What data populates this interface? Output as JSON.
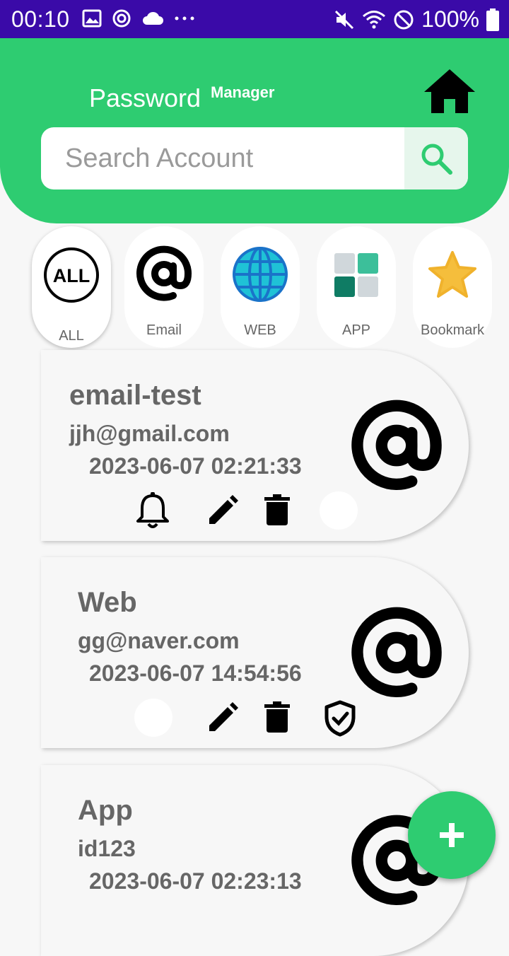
{
  "status_bar": {
    "time": "00:10",
    "battery": "100%"
  },
  "header": {
    "title": "Password",
    "title_sup": "Manager"
  },
  "search": {
    "placeholder": "Search Account"
  },
  "categories": [
    {
      "label": "ALL",
      "icon": "all-icon",
      "icon_text": "ALL",
      "active": true
    },
    {
      "label": "Email",
      "icon": "at-icon",
      "active": false
    },
    {
      "label": "WEB",
      "icon": "globe-icon",
      "active": false
    },
    {
      "label": "APP",
      "icon": "app-icon",
      "active": false
    },
    {
      "label": "Bookmark",
      "icon": "star-icon",
      "active": false
    }
  ],
  "accounts": [
    {
      "title": "email-test",
      "user": "jjh@gmail.com",
      "date": "2023-06-07 02:21:33",
      "icon": "at-icon",
      "alarm": true,
      "shield": false
    },
    {
      "title": "Web",
      "user": "gg@naver.com",
      "date": "2023-06-07 14:54:56",
      "icon": "at-icon",
      "alarm": false,
      "shield": true
    },
    {
      "title": "App",
      "user": "id123",
      "date": "2023-06-07 02:23:13",
      "icon": "at-icon",
      "alarm": false,
      "shield": false
    }
  ],
  "colors": {
    "brand": "#2ecc71",
    "status_bar": "#3a0aa8",
    "text_muted": "#666666"
  },
  "fab": {
    "icon": "plus-icon"
  }
}
